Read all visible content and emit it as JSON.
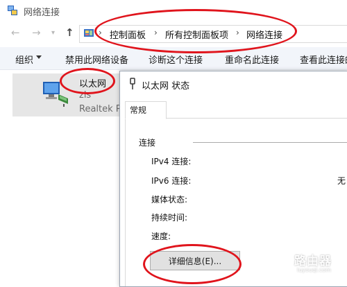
{
  "window": {
    "title": "网络连接",
    "icon": "network-connections-icon"
  },
  "nav": {
    "back_icon": "arrow-left-icon",
    "forward_icon": "arrow-right-icon",
    "recent_icon": "chevron-down-icon",
    "up_icon": "arrow-up-icon"
  },
  "breadcrumb": {
    "items": [
      "控制面板",
      "所有控制面板项",
      "网络连接"
    ],
    "separator": "›"
  },
  "commands": {
    "organize": "组织",
    "disable": "禁用此网络设备",
    "diagnose": "诊断这个连接",
    "rename": "重命名此连接",
    "view_status": "查看此连接的"
  },
  "adapter": {
    "name": "以太网",
    "network": "zls",
    "device": "Realtek P"
  },
  "dialog": {
    "title": "以太网 状态",
    "tab_general": "常规",
    "group_connection": "连接",
    "fields": [
      "IPv4 连接:",
      "IPv6 连接:",
      "媒体状态:",
      "持续时间:",
      "速度:"
    ],
    "ipv6_value": "无",
    "details_button": "详细信息(E)..."
  },
  "watermark": {
    "text": "路由器",
    "url": "luyouqi.com"
  },
  "colors": {
    "annotation": "#e0141c",
    "command_bar": "#f2f5fa",
    "selection": "#e6e6e6"
  }
}
